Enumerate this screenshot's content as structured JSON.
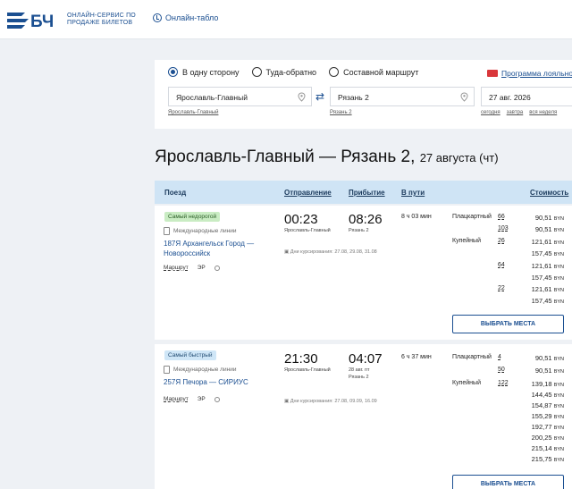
{
  "header": {
    "logo_text": "БЧ",
    "service_line1": "ОНЛАЙН-СЕРВИС ПО",
    "service_line2": "ПРОДАЖЕ БИЛЕТОВ",
    "online_board": "Онлайн-табло"
  },
  "search": {
    "trip_types": [
      "В одну сторону",
      "Туда-обратно",
      "Составной маршрут"
    ],
    "selected_trip_type": "В одну сторону",
    "loyalty_link": "Программа лояльности",
    "from": "Ярославль-Главный",
    "to": "Рязань 2",
    "date": "27 авг. 2026",
    "from_hint": "Ярославль-Главный",
    "to_hint": "Рязань 2",
    "date_hints": [
      "сегодня",
      "завтра",
      "вся неделя"
    ]
  },
  "title": {
    "route": "Ярославль-Главный — Рязань 2,",
    "date": "27 августа (чт)"
  },
  "table_header": {
    "train": "Поезд",
    "departure": "Отправление",
    "arrival": "Прибытие",
    "duration": "В пути",
    "cost": "Стоимость"
  },
  "trains": [
    {
      "badge": "Самый недорогой",
      "type": "Международные линии",
      "name": "187Я Архангельск Город — Новороссийск",
      "route_label": "Маршрут",
      "er": "ЭР",
      "dep_time": "00:23",
      "dep_station": "Ярославль-Главный",
      "arr_time": "08:26",
      "arr_station": "Рязань 2",
      "duration": "8 ч 03 мин",
      "days": "Дни курсирования: 27.08, 29.08, 31.08",
      "classes": [
        {
          "name": "Плацкартный",
          "seats": [
            "66",
            "103"
          ],
          "prices": [
            "90,51",
            "90,51"
          ]
        },
        {
          "name": "Купейный",
          "seats": [
            "26",
            "64",
            "22"
          ],
          "prices": [
            "121,61",
            "157,45",
            "121,61",
            "157,45",
            "121,61",
            "157,45"
          ]
        }
      ],
      "currency": "BYN",
      "button": "ВЫБРАТЬ МЕСТА"
    },
    {
      "badge": "Самый быстрый",
      "type": "Международные линии",
      "name": "257Я Печора — СИРИУС",
      "route_label": "Маршрут",
      "er": "ЭР",
      "dep_time": "21:30",
      "dep_station": "Ярославль-Главный",
      "arr_time": "04:07",
      "arr_date": "28 авг. пт",
      "arr_station": "Рязань 2",
      "duration": "6 ч 37 мин",
      "days": "Дни курсирования: 27.08, 09.09, 16.09",
      "classes": [
        {
          "name": "Плацкартный",
          "seats": [
            "4",
            "50"
          ],
          "prices": [
            "90,51",
            "90,51"
          ]
        },
        {
          "name": "Купейный",
          "seats": [
            "122"
          ],
          "prices": [
            "139,18",
            "144,45",
            "154,87",
            "155,29",
            "192,77",
            "200,25",
            "215,14",
            "215,75"
          ]
        }
      ],
      "currency": "BYN",
      "button": "ВЫБРАТЬ МЕСТА"
    }
  ],
  "colors": {
    "brand_blue": "#1b4f91",
    "header_row": "#cfe4f5",
    "badge_green": "#c9ecc3",
    "badge_blue": "#cfe6f7"
  }
}
